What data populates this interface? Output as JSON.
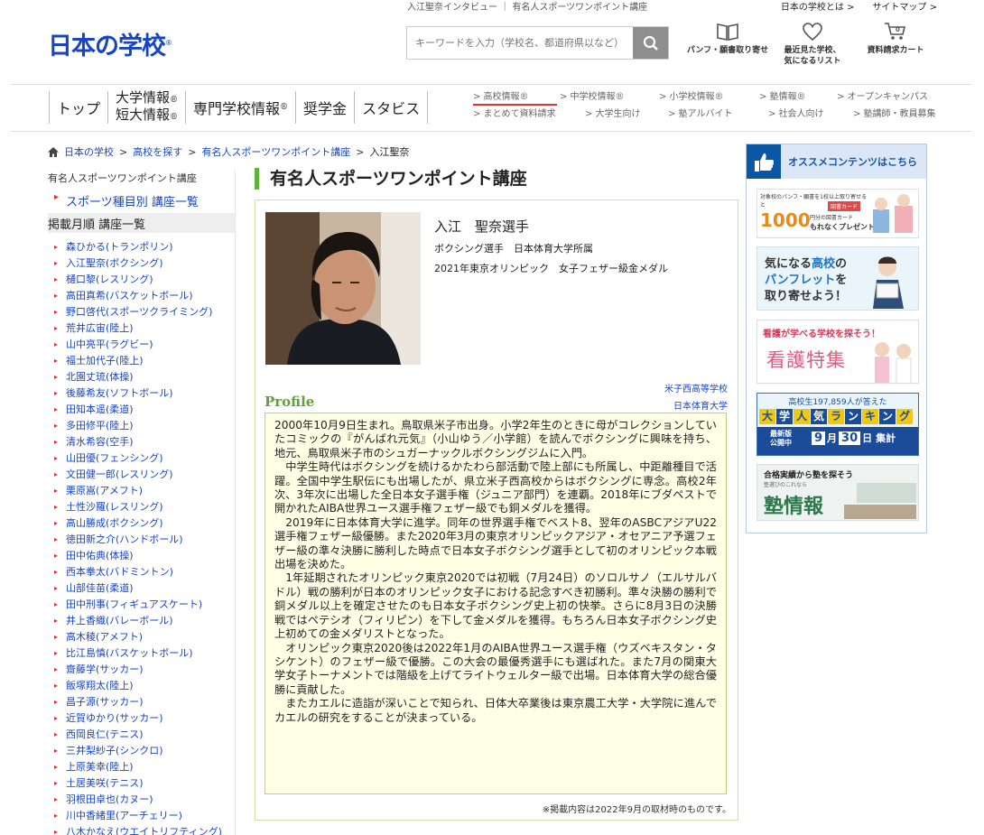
{
  "header": {
    "breadcrumb_top": "入江聖奈インタビュー ｜ 有名人スポーツワンポイント講座",
    "top_links": [
      "日本の学校とは >",
      "サイトマップ >"
    ],
    "logo_text": "日本の学校",
    "search_placeholder": "キーワードを入力（学校名、都道府県以など）",
    "icons": [
      {
        "label1": "パンフ・願書取り寄せ",
        "label2": "",
        "icon": "book-icon"
      },
      {
        "label1": "最近見た学校、",
        "label2": "気になるリスト",
        "icon": "heart-icon"
      },
      {
        "label1": "資料請求カート",
        "label2": "",
        "icon": "cart-icon"
      }
    ]
  },
  "gnav": {
    "items": [
      "トップ",
      "専門学校情報",
      "奨学金",
      "スタビス"
    ],
    "daigaku_top": "大学情報",
    "daigaku_bottom": "短大情報",
    "reg": "®"
  },
  "subnav": {
    "row1": [
      "> 高校情報®",
      "> 中学校情報®",
      "> 小学校情報®",
      "> 塾情報®",
      "> オープンキャンパス"
    ],
    "row2": [
      "> まとめて資料請求",
      "> 大学生向け",
      "> 塾アルバイト",
      "> 社会人向け",
      "> 塾講師・教員募集"
    ]
  },
  "breadcrumb": {
    "items": [
      "日本の学校",
      "高校を探す",
      "有名人スポーツワンポイント講座"
    ],
    "current": "入江聖奈",
    "separator": ">"
  },
  "sidebar": {
    "title": "有名人スポーツワンポイント講座",
    "main_links": [
      "スポーツ種目別 講座一覧",
      "掲載月順 講座一覧"
    ],
    "athletes": [
      "森ひかる(トランポリン)",
      "入江聖奈(ボクシング)",
      "樋口黎(レスリング)",
      "高田真希(バスケットボール)",
      "野口啓代(スポーツクライミング)",
      "荒井広宙(陸上)",
      "山中亮平(ラグビー)",
      "福士加代子(陸上)",
      "北園丈琉(体操)",
      "後藤希友(ソフトボール)",
      "田知本遥(柔道)",
      "多田修平(陸上)",
      "清水希容(空手)",
      "山田優(フェンシング)",
      "文田健一郎(レスリング)",
      "栗原嵩(アメフト)",
      "土性沙羅(レスリング)",
      "高山勝成(ボクシング)",
      "徳田新之介(ハンドボール)",
      "田中佑典(体操)",
      "西本拳太(バドミントン)",
      "山部佳苗(柔道)",
      "田中刑事(フィギュアスケート)",
      "井上香織(バレーボール)",
      "高木稜(アメフト)",
      "比江島慎(バスケットボール)",
      "齋藤学(サッカー)",
      "飯塚翔太(陸上)",
      "昌子源(サッカー)",
      "近賀ゆかり(サッカー)",
      "西岡良仁(テニス)",
      "三井梨紗子(シンクロ)",
      "上原美幸(陸上)",
      "土居美咲(テニス)",
      "羽根田卓也(カヌー)",
      "川中香緒里(アーチェリー)",
      "八木かなえ(ウエイトリフティング)"
    ]
  },
  "main": {
    "title": "有名人スポーツワンポイント講座",
    "name": "入江　聖奈選手",
    "info1": "ボクシング選手　日本体育大学所属",
    "info2": "2021年東京オリンピック　女子フェザー級金メダル",
    "schools": [
      "米子西高等学校",
      "日本体育大学"
    ],
    "profile_label": "Profile",
    "bio": [
      "2000年10月9日生まれ。鳥取県米子市出身。小学2年生のときに母がコレクションしていたコミックの『がんばれ元気』（小山ゆう／小学館）を読んでボクシングに興味を持ち、地元、鳥取県米子市のシュガーナックルボクシングジムに入門。",
      "中学生時代はボクシングを続けるかたわら部活動で陸上部にも所属し、中距離種目で活躍。全国中学生駅伝にも出場したが、県立米子西高校からはボクシングに専念。高校2年次、3年次に出場した全日本女子選手権（ジュニア部門）を連覇。2018年にブダペストで開かれたAIBA世界ユース選手権フェザー級でも銅メダルを獲得。",
      "2019年に日本体育大学に進学。同年の世界選手権でベスト8、翌年のASBCアジアU22選手権フェザー級優勝。また2020年3月の東京オリンピックアジア・オセアニア予選フェザー級の準々決勝に勝利した時点で日本女子ボクシング選手として初のオリンピック本戦出場を決めた。",
      "1年延期されたオリンピック東京2020では初戦（7月24日）のソロルサノ（エルサルバドル）戦の勝利が日本のオリンピック女子における記念すべき初勝利。準々決勝の勝利で銅メダル以上を確定させたのも日本女子ボクシング史上初の快挙。さらに8月3日の決勝戦ではペテシオ（フィリピン）を下して金メダルを獲得。もちろん日本女子ボクシング史上初めての金メダリストとなった。",
      "オリンピック東京2020後は2022年1月のAIBA世界ユース選手権（ウズベキスタン・タシケント）のフェザー級で優勝。この大会の最優秀選手にも選ばれた。また7月の関東大学女子トーナメントでは階級を上げてライトウェルター級で出場。日本体育大学の総合優勝に貢献した。",
      "またカエルに造詣が深いことで知られ、日体大卒業後は東京農工大学・大学院に進んでカエルの研究をすることが決まっている。"
    ],
    "note": "※掲載内容は2022年9月の取材時のものです。"
  },
  "right": {
    "header": "オススメコンテンツはこちら",
    "banner1_num": "1000",
    "banner1_sub": "もれなくプレゼント!",
    "banner1_top": "対象校のパンフ・願書を1校以上取り寄せると",
    "banner1_badge": "図書カード",
    "banner1_small": "円分の図書カード",
    "banner2_a": "気になる",
    "banner2_b": "高校",
    "banner2_c": "の",
    "banner2_d": "パンフレット",
    "banner2_e": "を",
    "banner2_f": "取り寄せよう！",
    "banner3_top": "看護が学べる学校を探そう！",
    "banner3_main": "看護特集",
    "banner4_top": "高校生197,859人が答えた",
    "banner4_chars": [
      "大",
      "学",
      "人",
      "気",
      "ラ",
      "ン",
      "キ",
      "ン",
      "グ"
    ],
    "banner4_label": "最新版\n公開中",
    "banner4_month": "9",
    "banner4_month_unit": "月",
    "banner4_day": "30",
    "banner4_day_unit": "日",
    "banner4_end": "集計",
    "banner5_top": "合格実績から塾を探そう",
    "banner5_sub": "塾選びのこれなら",
    "banner5_main": "塾情報"
  }
}
